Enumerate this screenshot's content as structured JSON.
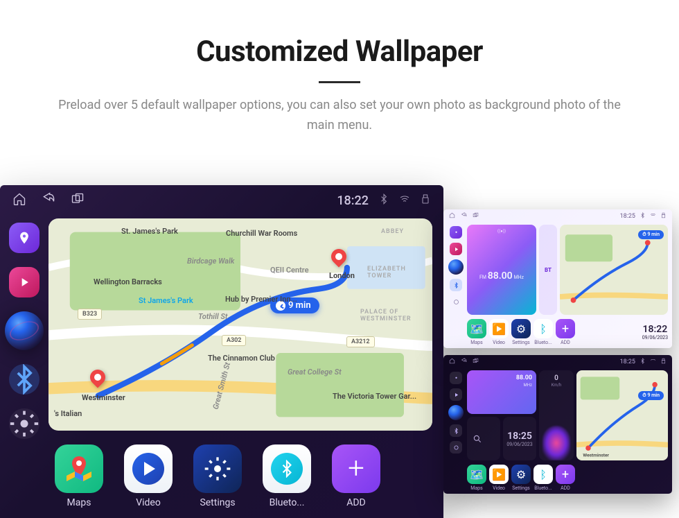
{
  "hero": {
    "title": "Customized Wallpaper",
    "subtitle": "Preload over 5 default wallpaper options, you can also set your own photo as background photo of the main menu."
  },
  "main": {
    "status": {
      "time": "18:22"
    },
    "map": {
      "eta_label": "9 min",
      "places": {
        "london": "London",
        "stjames": "St. James's Park",
        "westminster": "Westminster",
        "stjames2": "St James's Park",
        "wellington": "Wellington Barracks",
        "churchill": "Churchill War Rooms",
        "birdcage": "Birdcage Walk",
        "tothill": "Tothill St",
        "hub": "Hub by Premier Inn...",
        "abbey": "ABBEY",
        "eliz": "ELIZABETH TOWER",
        "palace": "PALACE OF WESTMINSTER",
        "qeii": "QEII Centre",
        "cinnamon": "The Cinnamon Club",
        "gcs": "Great College St",
        "victoria": "The Victoria Tower Gar...",
        "gsmith": "Great Smith St",
        "italian": "'s Italian"
      },
      "roads": {
        "b323": "B323",
        "a302": "A302",
        "a3212": "A3212"
      }
    },
    "dock": {
      "maps": "Maps",
      "video": "Video",
      "settings": "Settings",
      "bluetooth": "Blueto...",
      "add": "ADD"
    }
  },
  "small_a": {
    "status_time": "18:25",
    "bt_label": "BT",
    "fm": {
      "hint": "((●))",
      "freq_label": "FM",
      "freq_value": "88.00",
      "unit": "MHz"
    },
    "nav_eta": "9 min",
    "dock": {
      "maps": "Maps",
      "video": "Video",
      "settings": "Settings",
      "bluetooth": "Blueto...",
      "add": "ADD"
    },
    "clock": {
      "time": "18:22",
      "date": "09/06/2023"
    }
  },
  "small_b": {
    "status_time": "18:25",
    "fm": {
      "value": "88.00",
      "unit": "MHz"
    },
    "speed": {
      "value": "0",
      "unit": "Km/h"
    },
    "clock": {
      "time": "18:25",
      "date": "09/06/2023"
    },
    "nav_eta": "9 min",
    "map_place": "Westminster",
    "dock": {
      "maps": "Maps",
      "video": "Video",
      "settings": "Settings",
      "bluetooth": "Blueto...",
      "add": "ADD"
    }
  }
}
